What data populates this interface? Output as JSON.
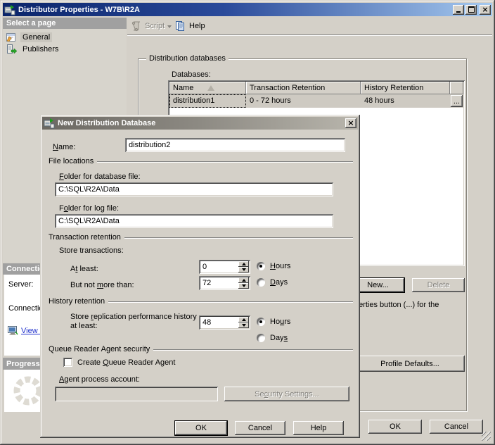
{
  "colors": {
    "window_face": "#d4d0c8",
    "titlebar_active_start": "#0a246a",
    "titlebar_active_end": "#a6caf0",
    "dialog_titlebar_start": "#6b6862",
    "dialog_titlebar_end": "#b8b5ac",
    "panel_header": "#a0a0a0",
    "link": "#2233cc",
    "selected_row": "#cecac2"
  },
  "window": {
    "title": "Distributor Properties - W7B\\R2A"
  },
  "sidebar": {
    "select_page_header": "Select a page",
    "pages": [
      {
        "label": "General",
        "selected": true
      },
      {
        "label": "Publishers",
        "selected": false
      }
    ],
    "connection_header": "Connection",
    "server_label": "Server:",
    "connection_label": "Connection:",
    "view_link": "View connection properties",
    "progress_header": "Progress"
  },
  "toolbar": {
    "script": "Script",
    "help": "Help"
  },
  "main": {
    "group_title": "Distribution databases",
    "databases_label": "Databases:",
    "table": {
      "columns": [
        "Name",
        "Transaction Retention",
        "History Retention"
      ],
      "rows": [
        {
          "name": "distribution1",
          "transaction_retention": "0 - 72 hours",
          "history_retention": "48 hours",
          "properties": "..."
        }
      ]
    },
    "new_button": "New...",
    "delete_button": "Delete",
    "helper_text": "To change the properties of a database, select the properties button (...) for the\ndatabase.",
    "profile_defaults_button": "Profile Defaults...",
    "ok_button": "OK",
    "cancel_button": "Cancel"
  },
  "dialog": {
    "title": "New Distribution Database",
    "name_label": {
      "pre": "",
      "u": "N",
      "post": "ame:"
    },
    "name_value": "distribution2",
    "file_locations_header": "File locations",
    "folder_db_label": {
      "pre": "",
      "u": "F",
      "post": "older for database file:"
    },
    "folder_db_value": "C:\\SQL\\R2A\\Data",
    "folder_log_label": {
      "pre": "F",
      "u": "o",
      "post": "lder for log file:"
    },
    "folder_log_value": "C:\\SQL\\R2A\\Data",
    "transaction_retention_header": "Transaction retention",
    "store_transactions_label": "Store transactions:",
    "at_least_label": {
      "pre": "A",
      "u": "t",
      "post": " least:"
    },
    "at_least_value": "0",
    "but_not_more_label": {
      "pre": "But not ",
      "u": "m",
      "post": "ore than:"
    },
    "but_not_more_value": "72",
    "tr_hours_label": {
      "pre": "",
      "u": "H",
      "post": "ours"
    },
    "tr_days_label": {
      "pre": "",
      "u": "D",
      "post": "ays"
    },
    "tr_unit_selected": "Hours",
    "history_retention_header": "History retention",
    "history_label": {
      "pre": "Store ",
      "u": "r",
      "post": "eplication performance history at least:"
    },
    "history_value": "48",
    "hr_hours_label": {
      "pre": "Ho",
      "u": "u",
      "post": "rs"
    },
    "hr_days_label": {
      "pre": "Day",
      "u": "s",
      "post": ""
    },
    "hr_unit_selected": "Hours",
    "queue_header": "Queue Reader Agent security",
    "create_queue_label": {
      "pre": "Create ",
      "u": "Q",
      "post": "ueue Reader Agent"
    },
    "create_queue_checked": false,
    "agent_account_label": {
      "pre": "",
      "u": "A",
      "post": "gent process account:"
    },
    "agent_account_value": "",
    "security_settings_button": {
      "pre": "Se",
      "u": "c",
      "post": "urity Settings..."
    },
    "ok_button": "OK",
    "cancel_button": "Cancel",
    "help_button": "Help"
  }
}
